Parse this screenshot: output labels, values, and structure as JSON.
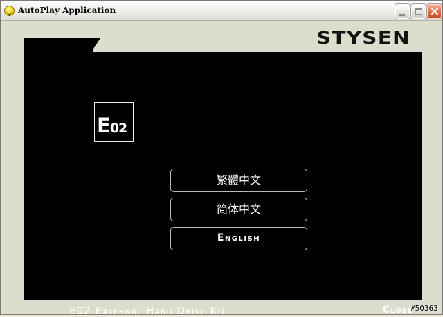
{
  "window": {
    "title": "AutoPlay Application",
    "app_icon": "smiley-icon",
    "controls": {
      "minimize": "minimize-icon",
      "maximize": "maximize-icon",
      "close": "close-icon"
    }
  },
  "brand": {
    "name": "STYSEN"
  },
  "product_logo": {
    "main": "E",
    "sub": "02"
  },
  "menu": {
    "buttons": [
      {
        "label": "繁體中文"
      },
      {
        "label": "简体中文"
      },
      {
        "label": "English"
      }
    ]
  },
  "footer": {
    "product_name": "E02 External Hard Drive Kit",
    "close_label": "Close"
  },
  "watermark": "#50363",
  "colors": {
    "panel_background": "#000000",
    "window_frame": "#ddddcd",
    "text": "#ffffff"
  }
}
